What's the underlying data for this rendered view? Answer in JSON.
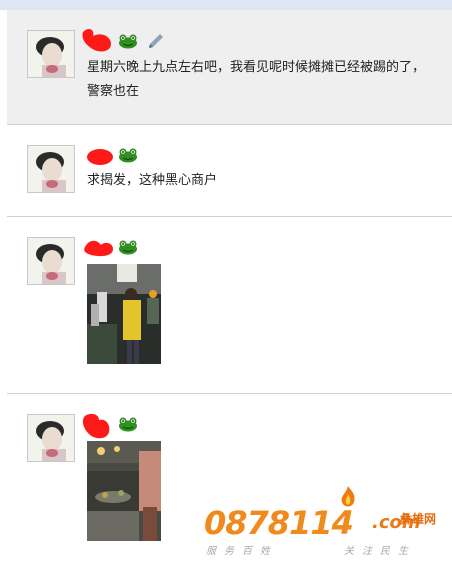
{
  "posts": [
    {
      "text": "星期六晚上九点左右吧，我看见呢时候摊摊已经被踢的了，警察也在",
      "has_edit_icon": true
    },
    {
      "text": "求揭发，这种黑心商户",
      "has_edit_icon": false
    },
    {
      "text": "",
      "has_photo": true
    },
    {
      "text": "",
      "has_photo": true
    }
  ],
  "icons": {
    "frog": "frog-emoticon-icon",
    "edit": "pencil-icon"
  },
  "watermark": {
    "number": "0878114",
    "site": ".com",
    "brand": "彝雄网",
    "slogan_left": "服务百姓",
    "slogan_right": "关注民生"
  },
  "colors": {
    "name_mark": "#ff1a1a",
    "frog": "#2f8f1f",
    "watermark_orange": "#f08a1d"
  }
}
